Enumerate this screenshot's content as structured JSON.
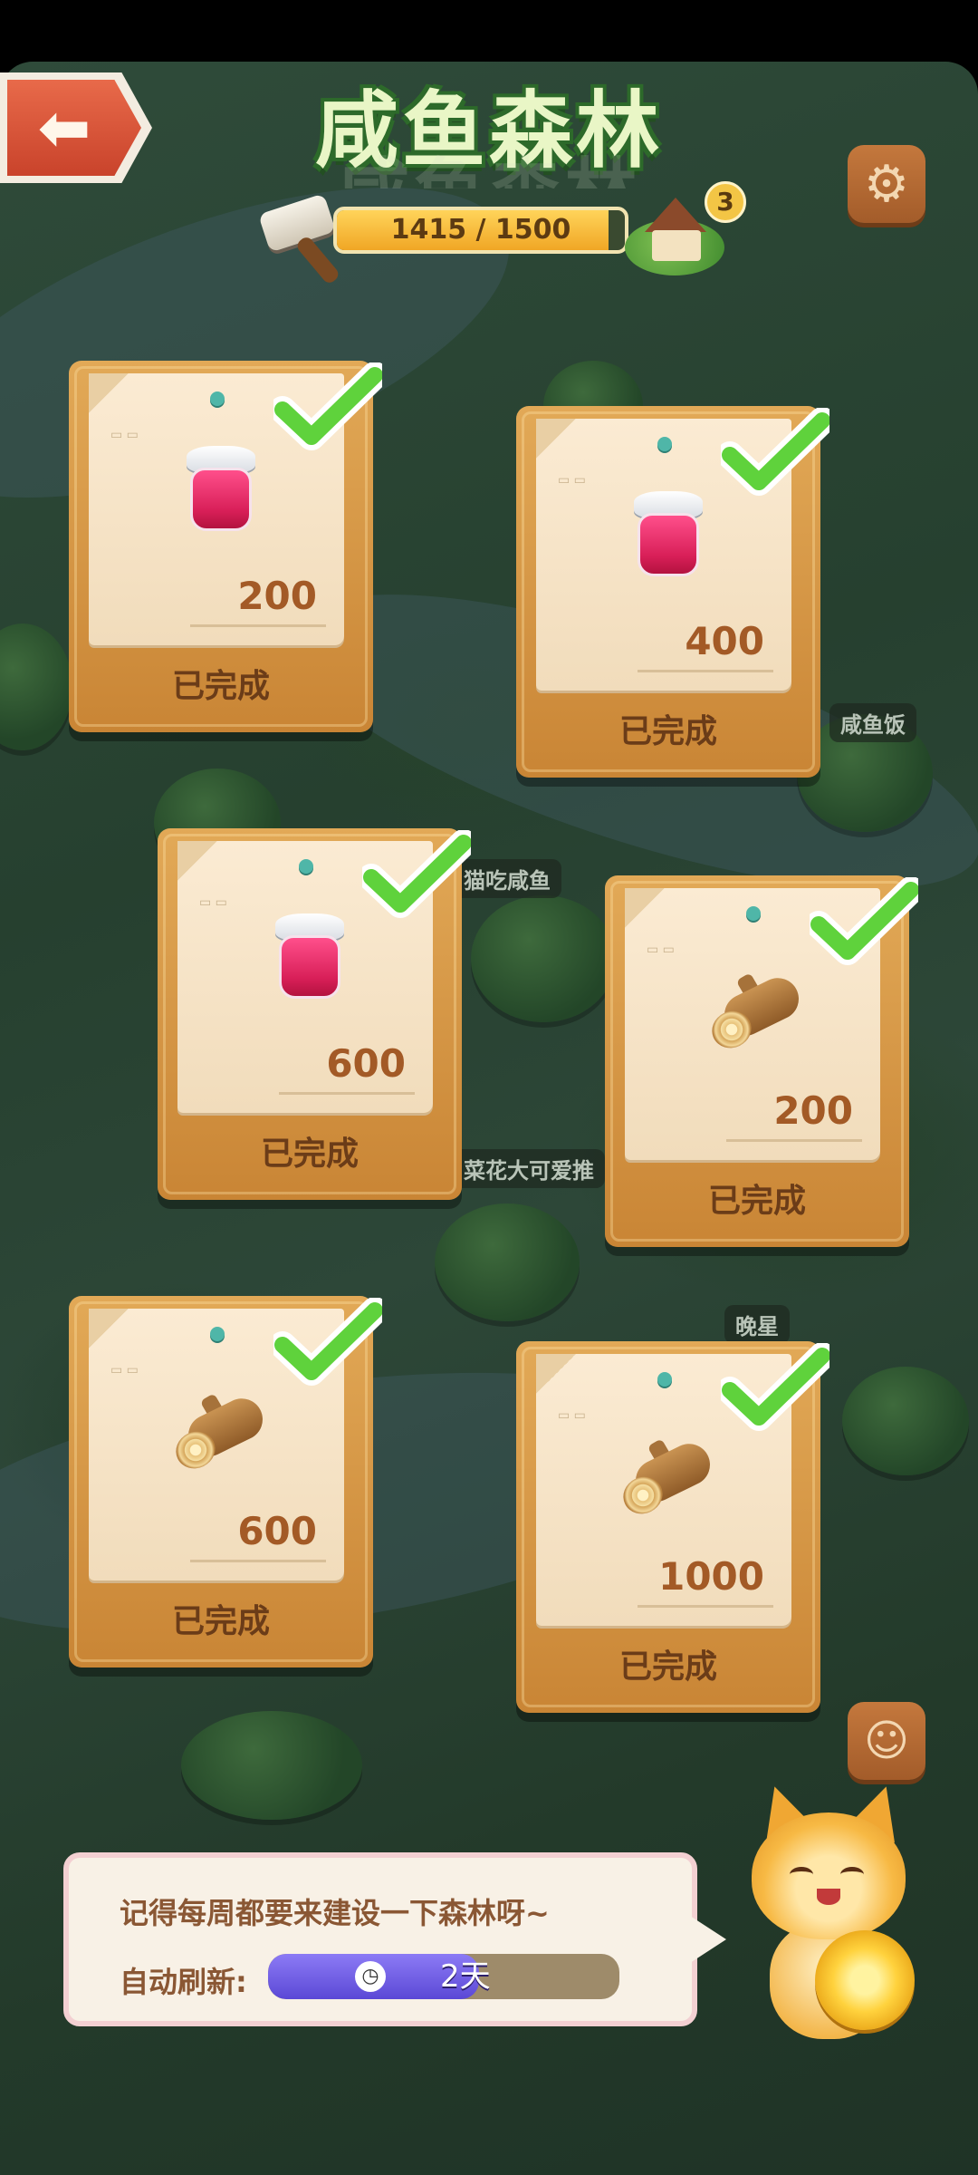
{
  "title": "咸鱼森林",
  "header": {
    "back_icon": "arrow-left-icon",
    "settings_icon": "gear-icon",
    "progress": {
      "current": 1415,
      "max": 1500,
      "text": "1415 / 1500"
    },
    "house_count": "3"
  },
  "map_labels": [
    "咸鱼饭",
    "猫吃咸鱼",
    "菜花大可爱推",
    "晚星"
  ],
  "cards": [
    {
      "item": "jam",
      "amount": "200",
      "status": "已完成"
    },
    {
      "item": "jam",
      "amount": "400",
      "status": "已完成"
    },
    {
      "item": "jam",
      "amount": "600",
      "status": "已完成"
    },
    {
      "item": "wood",
      "amount": "200",
      "status": "已完成"
    },
    {
      "item": "wood",
      "amount": "600",
      "status": "已完成"
    },
    {
      "item": "wood",
      "amount": "1000",
      "status": "已完成"
    }
  ],
  "dialog": {
    "message": "记得每周都要来建设一下森林呀~",
    "refresh_label": "自动刷新:",
    "refresh_value": "2天",
    "refresh_fraction": 0.6
  },
  "colors": {
    "check_green": "#5fd23c",
    "card_wood": "#d8994a",
    "progress_fill": "#f5b52e"
  }
}
